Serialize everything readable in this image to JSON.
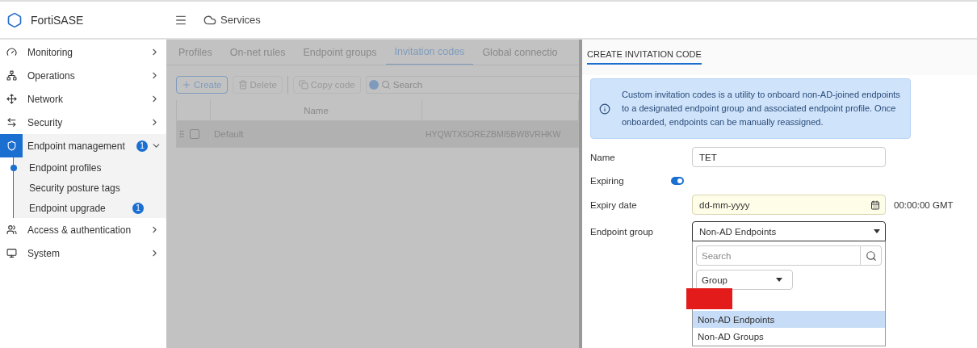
{
  "header": {
    "brand": "FortiSASE",
    "breadcrumb": "Services"
  },
  "sidebar": {
    "items": [
      {
        "label": "Monitoring",
        "expanded": false,
        "selected": false
      },
      {
        "label": "Operations",
        "expanded": false,
        "selected": false
      },
      {
        "label": "Network",
        "expanded": false,
        "selected": false
      },
      {
        "label": "Security",
        "expanded": false,
        "selected": false
      },
      {
        "label": "Endpoint management",
        "expanded": true,
        "selected": true,
        "badge": "1",
        "children": [
          {
            "label": "Endpoint profiles",
            "selected": true
          },
          {
            "label": "Security posture tags",
            "selected": false
          },
          {
            "label": "Endpoint upgrade",
            "selected": false,
            "badge": "1"
          }
        ]
      },
      {
        "label": "Access & authentication",
        "expanded": false,
        "selected": false
      },
      {
        "label": "System",
        "expanded": false,
        "selected": false
      }
    ]
  },
  "tabs": [
    {
      "label": "Profiles",
      "selected": false
    },
    {
      "label": "On-net rules",
      "selected": false
    },
    {
      "label": "Endpoint groups",
      "selected": false
    },
    {
      "label": "Invitation codes",
      "selected": true
    },
    {
      "label": "Global connectio",
      "selected": false
    }
  ],
  "toolbar": {
    "buttons": [
      {
        "label": "Create",
        "disabled": false
      },
      {
        "label": "Delete",
        "disabled": true
      },
      {
        "label": "Copy code",
        "disabled": true
      }
    ],
    "search": {
      "placeholder": "Search"
    }
  },
  "table": {
    "columns": [
      "Name"
    ],
    "rows": [
      {
        "checked": false,
        "cells": [
          "Default",
          "HYQWTX5OREZBMI5BW8VRHKW"
        ]
      }
    ]
  },
  "panel": {
    "title": "CREATE INVITATION CODE",
    "info": "Custom invitation codes is a utility to onboard non-AD-joined endpoints to a designated endpoint group and associated endpoint profile. Once onboarded, endpoints can be manually reassigned.",
    "name": {
      "label": "Name",
      "value": "TET"
    },
    "expiring": {
      "label": "Expiring",
      "on": true
    },
    "expiry_date": {
      "label": "Expiry date",
      "placeholder": "dd-mm-yyyy",
      "time": "00:00:00 GMT"
    },
    "endpoint_group": {
      "label": "Endpoint group",
      "value": "Non-AD Endpoints",
      "dropdown": {
        "search": {
          "placeholder": "Search"
        },
        "filter": "Group",
        "options": [
          {
            "label": "Non-AD Endpoints",
            "selected": true
          },
          {
            "label": "Non-AD Groups",
            "selected": false
          }
        ]
      }
    }
  }
}
